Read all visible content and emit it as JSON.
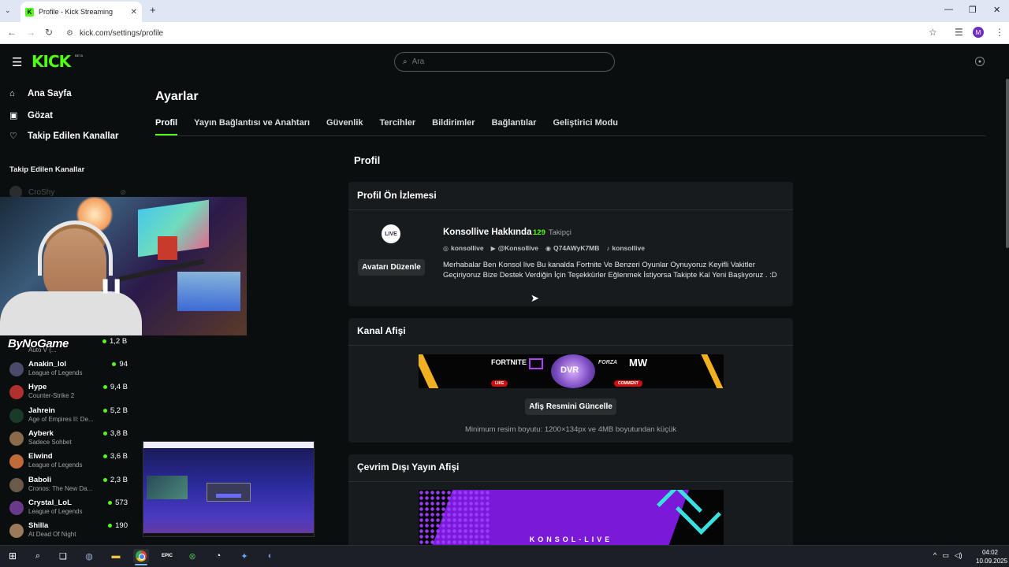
{
  "browser": {
    "tab_title": "Profile - Kick Streaming",
    "tab_close": "✕",
    "new_tab": "+",
    "url": "kick.com/settings/profile",
    "profile_initial": "M",
    "win_min": "—",
    "win_restore": "❐",
    "win_close": "✕"
  },
  "header": {
    "logo": "KICK",
    "beta": "BETA",
    "search_placeholder": "Ara"
  },
  "sidebar": {
    "nav": [
      {
        "label": "Ana Sayfa",
        "icon": "⌂"
      },
      {
        "label": "Gözat",
        "icon": "▣"
      },
      {
        "label": "Takip Edilen Kanallar",
        "icon": "♡"
      }
    ],
    "heading": "Takip Edilen Kanallar",
    "offline_channel": "CroShy",
    "partial_channel": {
      "game": "Auto V (...",
      "viewers": "1,2 B"
    },
    "channels": [
      {
        "name": "Anakin_lol",
        "game": "League of Legends",
        "viewers": "94",
        "color": "#4a4a6a"
      },
      {
        "name": "Hype",
        "game": "Counter-Strike 2",
        "viewers": "9,4 B",
        "color": "#b03030"
      },
      {
        "name": "Jahrein",
        "game": "Age of Empires II: De...",
        "viewers": "5,2 B",
        "color": "#1a3a2a"
      },
      {
        "name": "Ayberk",
        "game": "Sadece Sohbet",
        "viewers": "3,8 B",
        "color": "#8a6a4a"
      },
      {
        "name": "Elwind",
        "game": "League of Legends",
        "viewers": "3,6 B",
        "color": "#c06a3a"
      },
      {
        "name": "Baboli",
        "game": "Cronos: The New Da...",
        "viewers": "2,3 B",
        "color": "#6a5a4a"
      },
      {
        "name": "Crystal_LoL",
        "game": "League of Legends",
        "viewers": "573",
        "color": "#6a3a8a"
      },
      {
        "name": "Shilla",
        "game": "At Dead Of Night",
        "viewers": "190",
        "color": "#9a7a5a"
      }
    ]
  },
  "overlay": {
    "brand": "ByNoGame"
  },
  "settings": {
    "title": "Ayarlar",
    "tabs": [
      "Profil",
      "Yayın Bağlantısı ve Anahtarı",
      "Güvenlik",
      "Tercihler",
      "Bildirimler",
      "Bağlantılar",
      "Geliştirici Modu"
    ],
    "section_title": "Profil",
    "preview": {
      "heading": "Profil Ön İzlemesi",
      "edit_avatar": "Avatarı Düzenle",
      "about_title": "Konsollive Hakkında",
      "followers_count": "129",
      "followers_label": "Takipçi",
      "socials": [
        {
          "icon": "◎",
          "label": "konsollive"
        },
        {
          "icon": "▶",
          "label": "@Konsollive"
        },
        {
          "icon": "◉",
          "label": "Q74AWyK7MB"
        },
        {
          "icon": "♪",
          "label": "konsollive"
        }
      ],
      "bio": "Merhabalar Ben Konsol live Bu kanalda Fortnite Ve Benzeri Oyunlar Oynuyoruz Keyifli Vakitler Geçiriyoruz Bize Destek Verdiğin İçin Teşekkürler Eğlenmek İstiyorsa Takipte Kal Yeni Başlıyoruz . :D"
    },
    "banner": {
      "heading": "Kanal Afişi",
      "texts": {
        "fortnite": "FORTNITE",
        "logo": "DVR",
        "fh": "FORZA",
        "mw": "MW",
        "like": "LIKE",
        "comment": "COMMENT"
      },
      "update_button": "Afiş Resmini Güncelle",
      "note": "Minimum resim boyutu: 1200×134px ve 4MB boyutundan küçük"
    },
    "offline": {
      "heading": "Çevrim Dışı Yayın Afişi",
      "text": "KONSOL-LIVE"
    }
  },
  "taskbar": {
    "time": "04:02",
    "date": "10.09.2025",
    "epic": "EPIC"
  }
}
